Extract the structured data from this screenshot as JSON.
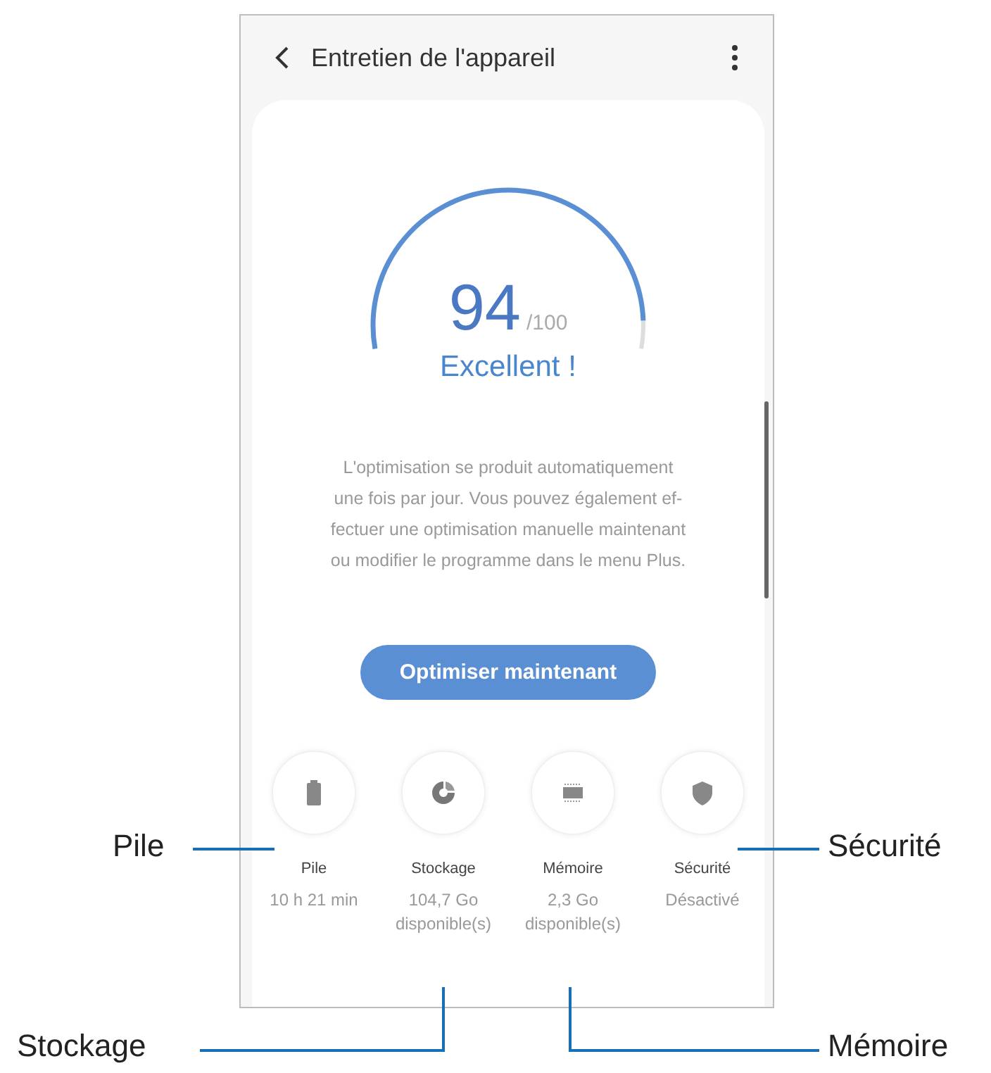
{
  "header": {
    "title": "Entretien de l'appareil"
  },
  "gauge": {
    "score": "94",
    "max": "/100",
    "rating": "Excellent !"
  },
  "description": [
    "L'optimisation se produit automatiquement",
    "une fois par jour. Vous pouvez également ef-",
    "fectuer une optimisation manuelle maintenant",
    "ou modifier le programme dans le menu Plus."
  ],
  "button": "Optimiser maintenant",
  "items": [
    {
      "kind": "battery",
      "label": "Pile",
      "value": "10 h 21 min"
    },
    {
      "kind": "storage",
      "label": "Stockage",
      "value": "104,7 Go disponible(s)"
    },
    {
      "kind": "memory",
      "label": "Mémoire",
      "value": "2,3 Go disponible(s)"
    },
    {
      "kind": "security",
      "label": "Sécurité",
      "value": "Désactivé"
    }
  ],
  "callouts": [
    {
      "label": "Pile",
      "kind": "left"
    },
    {
      "label": "Sécurité",
      "kind": "right"
    },
    {
      "label": "Stockage",
      "kind": "bottomleft"
    },
    {
      "label": "Mémoire",
      "kind": "bottomright"
    }
  ]
}
